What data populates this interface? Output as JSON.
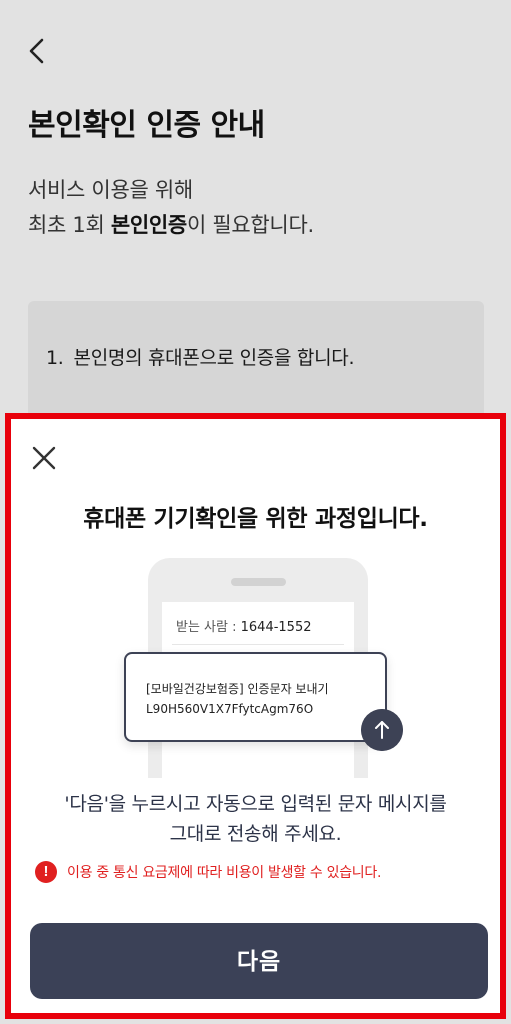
{
  "page": {
    "back_icon": "chevron-left-icon",
    "title": "본인확인 인증 안내",
    "desc_line1": "서비스 이용을 위해",
    "desc_line2_prefix": "최초 1회 ",
    "desc_line2_bold": "본인인증",
    "desc_line2_suffix": "이 필요합니다.",
    "info_item_number": "1.",
    "info_item_text": "본인명의 휴대폰으로 인증을 합니다."
  },
  "sheet": {
    "frame_color": "#e8000b",
    "close_icon": "close-icon",
    "title": "휴대폰 기기확인을 위한 과정입니다.",
    "illustration": {
      "recipient_label": "받는 사람 : ",
      "recipient_number": "1644-1552",
      "message_line1": "[모바일건강보험증] 인증문자 보내기",
      "message_line2": "L90H560V1X7FfytcAgm76O",
      "send_icon": "arrow-up-icon"
    },
    "instruction_line1": "'다음'을 누르시고 자동으로 입력된 문자 메시지를",
    "instruction_line2": "그대로 전송해 주세요.",
    "warning_icon_glyph": "!",
    "warning_text": "이용 중 통신 요금제에 따라 비용이 발생할 수 있습니다.",
    "warning_color": "#e02020",
    "next_button_label": "다음",
    "button_color": "#3b4157"
  }
}
